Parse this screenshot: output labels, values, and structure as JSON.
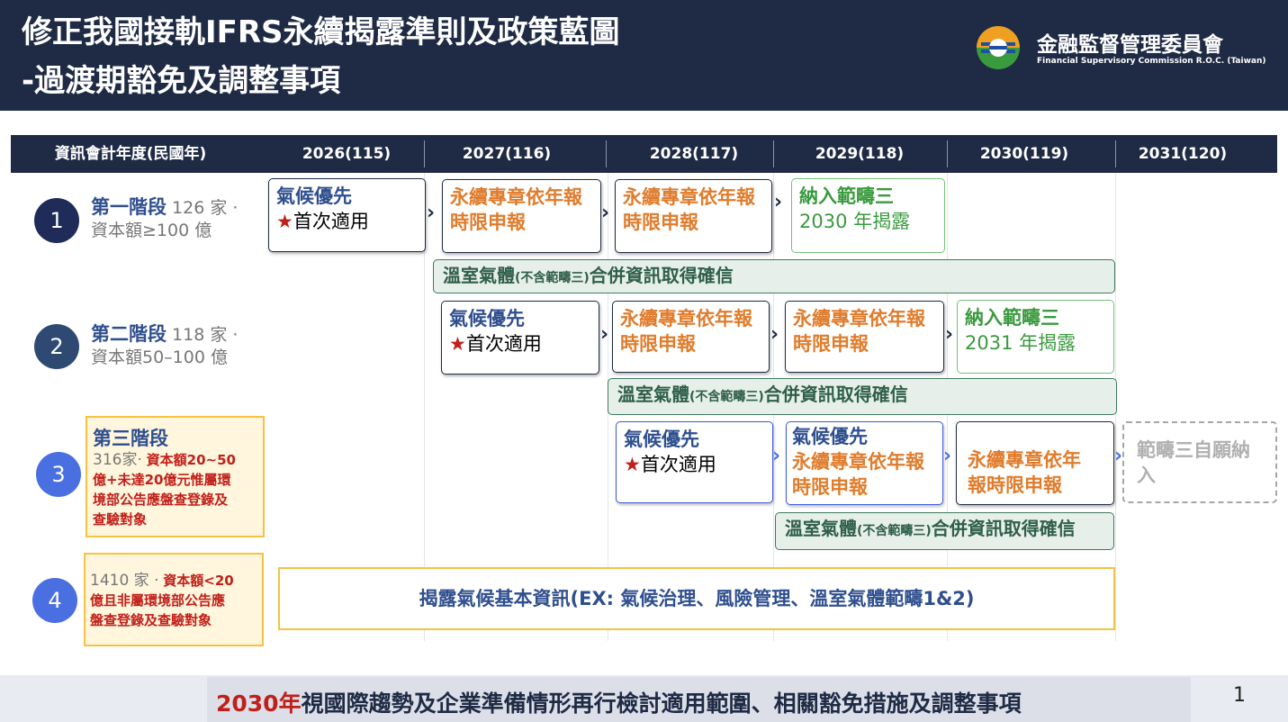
{
  "header": {
    "title_line1": "修正我國接軌IFRS永續揭露準則及政策藍圖",
    "title_line2": "-過渡期豁免及調整事項",
    "org_name_zh": "金融監督管理委員會",
    "org_name_en": "Financial Supervisory Commission R.O.C. (Taiwan)"
  },
  "timeline": {
    "label": "資訊會計年度(民國年)",
    "years": [
      "2026(115)",
      "2027(116)",
      "2028(117)",
      "2029(118)",
      "2030(119)",
      "2031(120)"
    ]
  },
  "stages": [
    {
      "num": "1",
      "name": "第一階段",
      "count": "126 家 ·",
      "detail": "資本額≥100 億"
    },
    {
      "num": "2",
      "name": "第二階段",
      "count": "118 家 ·",
      "detail": "資本額50–100 億"
    },
    {
      "num": "3",
      "name": "第三階段",
      "count": "316家·",
      "detail_red1": "資本額20~50",
      "detail_red2": "億+未達20億元惟屬環",
      "detail_red3": "境部公告應盤查登錄及",
      "detail_red4": "查驗對象"
    },
    {
      "num": "4",
      "count": "1410 家 ·",
      "detail_red1": "資本額<20",
      "detail_red2": "億且非屬環境部公告應",
      "detail_red3": "盤查登錄及查驗對象"
    }
  ],
  "boxes": {
    "climate_first": "氣候優先",
    "first_apply": "首次適用",
    "star": "★",
    "sustain_l1": "永續專章依年報",
    "sustain_l2": "時限申報",
    "sustain3_l1": "永續專章依年",
    "sustain3_l2": "報時限申報",
    "scope3": "納入範疇三",
    "scope3_2030": "2030 年揭露",
    "scope3_2031": "2031 年揭露",
    "voluntary_l1": "範疇三自願納",
    "voluntary_l2": "入",
    "ghg_main1": "溫室氣體",
    "ghg_small": "(不含範疇三)",
    "ghg_main2": "合併資訊取得確信",
    "disclose_basic": "揭露氣候基本資訊(EX: 氣候治理、風險管理、溫室氣體範疇1&2)",
    "arrow": "›"
  },
  "footer": {
    "year": "2030年",
    "text": "視國際趨勢及企業準備情形再行檢討適用範圍、相關豁免措施及調整事項",
    "page": "1"
  },
  "colors": {
    "navy": "#1f2b45",
    "accent_blue": "#2f4f8f",
    "orange": "#e07c2c",
    "green": "#3a9a3e",
    "red": "#c0201a",
    "yellow_border": "#f5c242"
  }
}
